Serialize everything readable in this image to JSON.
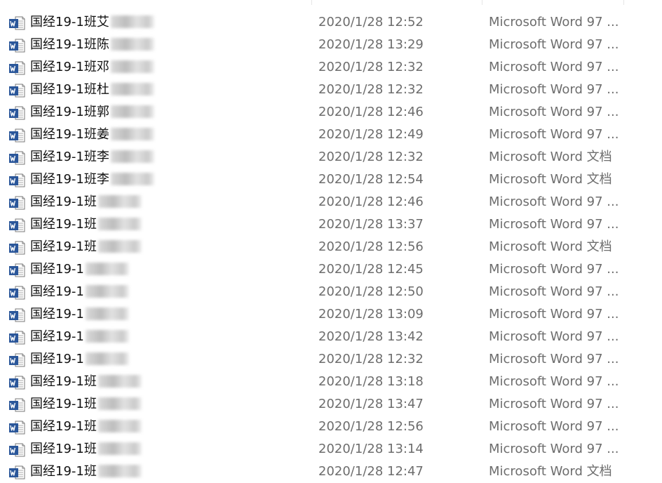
{
  "files": [
    {
      "name": "国经19-1班艾",
      "date": "2020/1/28 12:52",
      "type": "Microsoft Word 97 ...",
      "icon": "word-97-icon"
    },
    {
      "name": "国经19-1班陈",
      "date": "2020/1/28 13:29",
      "type": "Microsoft Word 97 ...",
      "icon": "word-97-icon"
    },
    {
      "name": "国经19-1班邓",
      "date": "2020/1/28 12:32",
      "type": "Microsoft Word 97 ...",
      "icon": "word-97-icon"
    },
    {
      "name": "国经19-1班杜",
      "date": "2020/1/28 12:32",
      "type": "Microsoft Word 97 ...",
      "icon": "word-97-icon"
    },
    {
      "name": "国经19-1班郭",
      "date": "2020/1/28 12:46",
      "type": "Microsoft Word 97 ...",
      "icon": "word-97-icon"
    },
    {
      "name": "国经19-1班姜",
      "date": "2020/1/28 12:49",
      "type": "Microsoft Word 97 ...",
      "icon": "word-97-icon"
    },
    {
      "name": "国经19-1班李",
      "date": "2020/1/28 12:32",
      "type": "Microsoft Word 文档",
      "icon": "word-docx-icon"
    },
    {
      "name": "国经19-1班李",
      "date": "2020/1/28 12:54",
      "type": "Microsoft Word 文档",
      "icon": "word-docx-icon"
    },
    {
      "name": "国经19-1班",
      "date": "2020/1/28 12:46",
      "type": "Microsoft Word 97 ...",
      "icon": "word-97-icon"
    },
    {
      "name": "国经19-1班",
      "date": "2020/1/28 13:37",
      "type": "Microsoft Word 97 ...",
      "icon": "word-97-icon"
    },
    {
      "name": "国经19-1班",
      "date": "2020/1/28 12:56",
      "type": "Microsoft Word 文档",
      "icon": "word-docx-icon"
    },
    {
      "name": "国经19-1",
      "date": "2020/1/28 12:45",
      "type": "Microsoft Word 97 ...",
      "icon": "word-97-icon"
    },
    {
      "name": "国经19-1",
      "date": "2020/1/28 12:50",
      "type": "Microsoft Word 97 ...",
      "icon": "word-97-icon"
    },
    {
      "name": "国经19-1",
      "date": "2020/1/28 13:09",
      "type": "Microsoft Word 97 ...",
      "icon": "word-97-icon"
    },
    {
      "name": "国经19-1",
      "date": "2020/1/28 13:42",
      "type": "Microsoft Word 97 ...",
      "icon": "word-97-icon"
    },
    {
      "name": "国经19-1",
      "date": "2020/1/28 12:32",
      "type": "Microsoft Word 97 ...",
      "icon": "word-97-icon"
    },
    {
      "name": "国经19-1班",
      "date": "2020/1/28 13:18",
      "type": "Microsoft Word 97 ...",
      "icon": "word-97-icon"
    },
    {
      "name": "国经19-1班",
      "date": "2020/1/28 13:47",
      "type": "Microsoft Word 97 ...",
      "icon": "word-97-icon"
    },
    {
      "name": "国经19-1班",
      "date": "2020/1/28 12:56",
      "type": "Microsoft Word 97 ...",
      "icon": "word-97-icon"
    },
    {
      "name": "国经19-1班",
      "date": "2020/1/28 13:14",
      "type": "Microsoft Word 97 ...",
      "icon": "word-97-icon"
    },
    {
      "name": "国经19-1班",
      "date": "2020/1/28 12:47",
      "type": "Microsoft Word 文档",
      "icon": "word-docx-icon"
    }
  ],
  "colors": {
    "word_blue": "#2b579a",
    "secondary_text": "#6d6d6d",
    "column_divider": "#e5e5e5"
  }
}
